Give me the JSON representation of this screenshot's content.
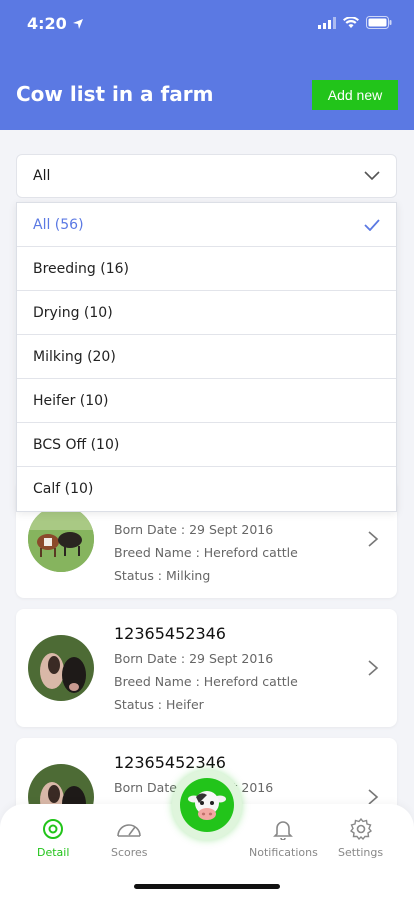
{
  "status_bar": {
    "time": "4:20"
  },
  "header": {
    "title": "Cow list in a farm",
    "add_button": "Add new"
  },
  "filter": {
    "selected": "All"
  },
  "dropdown": {
    "items": [
      {
        "label": "All (56)",
        "selected": true
      },
      {
        "label": "Breeding (16)"
      },
      {
        "label": "Drying (10)"
      },
      {
        "label": "Milking (20)"
      },
      {
        "label": "Heifer (10)"
      },
      {
        "label": "BCS Off (10)"
      },
      {
        "label": "Calf (10)"
      }
    ]
  },
  "cows": [
    {
      "id": "",
      "born": "Born Date : 29 Sept 2016",
      "breed": "Breed Name : Hereford cattle",
      "status": "Status : Milking"
    },
    {
      "id": "12365452346",
      "born": "Born Date : 29 Sept 2016",
      "breed": "Breed Name : Hereford cattle",
      "status": "Status : Heifer"
    },
    {
      "id": "12365452346",
      "born": "Born Date : 29 Sept 2016",
      "breed": "",
      "status": ""
    }
  ],
  "nav": {
    "detail": "Detail",
    "scores": "Scores",
    "notifications": "Notifications",
    "settings": "Settings"
  },
  "colors": {
    "primary": "#5b79e3",
    "accent": "#22c41a"
  }
}
